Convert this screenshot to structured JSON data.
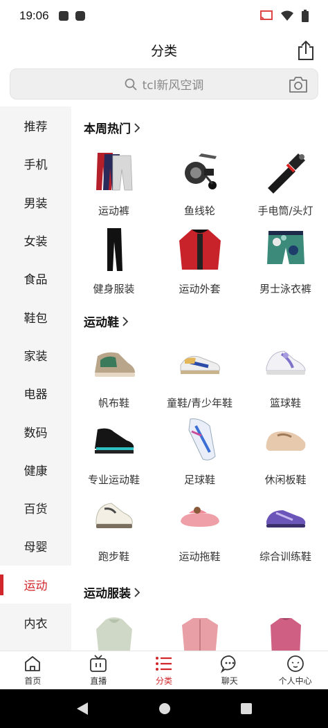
{
  "status_bar": {
    "time": "19:06"
  },
  "header": {
    "title": "分类"
  },
  "search": {
    "placeholder": "tcl新风空调"
  },
  "sidebar": {
    "items": [
      {
        "label": "推荐"
      },
      {
        "label": "手机"
      },
      {
        "label": "男装"
      },
      {
        "label": "女装"
      },
      {
        "label": "食品"
      },
      {
        "label": "鞋包"
      },
      {
        "label": "家装"
      },
      {
        "label": "电器"
      },
      {
        "label": "数码"
      },
      {
        "label": "健康"
      },
      {
        "label": "百货"
      },
      {
        "label": "母婴"
      },
      {
        "label": "运动"
      },
      {
        "label": "内衣"
      }
    ],
    "active": "运动"
  },
  "sections": [
    {
      "title": "本周热门",
      "items": [
        {
          "label": "运动裤",
          "icon": "sweatpants-icon"
        },
        {
          "label": "鱼线轮",
          "icon": "fishing-reel-icon"
        },
        {
          "label": "手电筒/头灯",
          "icon": "flashlight-icon"
        },
        {
          "label": "健身服装",
          "icon": "leggings-icon"
        },
        {
          "label": "运动外套",
          "icon": "jacket-icon"
        },
        {
          "label": "男士泳衣裤",
          "icon": "swim-shorts-icon"
        }
      ]
    },
    {
      "title": "运动鞋",
      "items": [
        {
          "label": "帆布鞋",
          "icon": "canvas-shoe-icon"
        },
        {
          "label": "童鞋/青少年鞋",
          "icon": "kids-shoe-icon"
        },
        {
          "label": "篮球鞋",
          "icon": "basketball-shoe-icon"
        },
        {
          "label": "专业运动鞋",
          "icon": "pro-sport-shoe-icon"
        },
        {
          "label": "足球鞋",
          "icon": "football-shoe-icon"
        },
        {
          "label": "休闲板鞋",
          "icon": "casual-shoe-icon"
        },
        {
          "label": "跑步鞋",
          "icon": "running-shoe-icon"
        },
        {
          "label": "运动拖鞋",
          "icon": "slipper-icon"
        },
        {
          "label": "综合训练鞋",
          "icon": "training-shoe-icon"
        }
      ]
    },
    {
      "title": "运动服装",
      "items": [
        {
          "label": "",
          "icon": "hoodie-icon"
        },
        {
          "label": "",
          "icon": "shirt-icon"
        },
        {
          "label": "",
          "icon": "top-icon"
        }
      ]
    }
  ],
  "bottom_nav": {
    "items": [
      {
        "label": "首页",
        "icon": "home-icon"
      },
      {
        "label": "直播",
        "icon": "tv-icon"
      },
      {
        "label": "分类",
        "icon": "category-icon"
      },
      {
        "label": "聊天",
        "icon": "chat-icon"
      },
      {
        "label": "个人中心",
        "icon": "profile-icon"
      }
    ],
    "active": "分类"
  },
  "colors": {
    "accent": "#d1262b",
    "sidebar_bg": "#f5f5f5",
    "search_bg": "#efefef"
  }
}
